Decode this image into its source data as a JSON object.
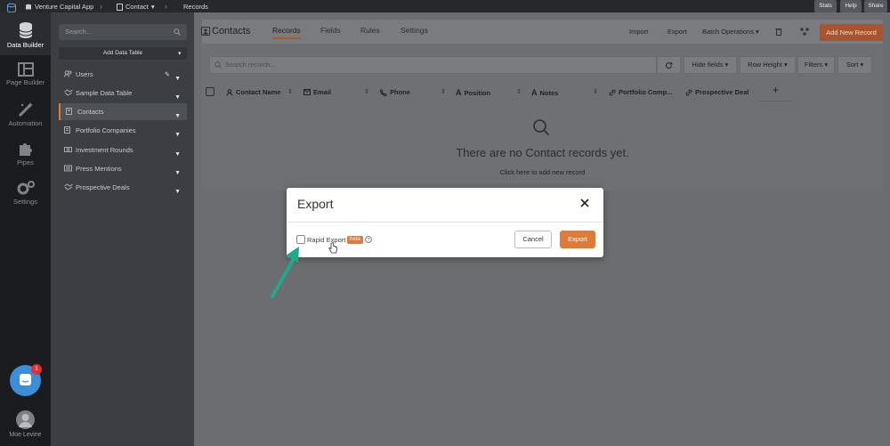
{
  "topbar": {
    "app_name": "Venture Capital App",
    "object": "Contact",
    "page": "Records",
    "buttons": [
      "Stats",
      "Help",
      "Share"
    ]
  },
  "rail": {
    "items": [
      {
        "label": "Data Builder",
        "icon": "database-icon"
      },
      {
        "label": "Page Builder",
        "icon": "layout-icon"
      },
      {
        "label": "Automation",
        "icon": "magic-wand-icon"
      },
      {
        "label": "Pipes",
        "icon": "puzzle-icon"
      },
      {
        "label": "Settings",
        "icon": "gear-icon"
      }
    ],
    "user_name": "Moe Levine",
    "chat_badge": "1"
  },
  "sidebar": {
    "search_placeholder": "Search...",
    "add_table_label": "Add Data Table",
    "items": [
      {
        "label": "Users",
        "icon": "users-icon"
      },
      {
        "label": "Sample Data Table",
        "icon": "handshake-icon"
      },
      {
        "label": "Contacts",
        "icon": "contact-icon"
      },
      {
        "label": "Portfolio Companies",
        "icon": "building-icon"
      },
      {
        "label": "Investment Rounds",
        "icon": "dollar-icon"
      },
      {
        "label": "Press Mentions",
        "icon": "newspaper-icon"
      },
      {
        "label": "Prospective Deals",
        "icon": "handshake-icon"
      }
    ]
  },
  "main": {
    "title": "Contacts",
    "tabs": [
      "Records",
      "Fields",
      "Rules",
      "Settings"
    ],
    "header_links": [
      "Import",
      "Export",
      "Batch Operations"
    ],
    "add_record_label": "Add New Record",
    "search_placeholder": "Search records...",
    "toolbar": [
      "Hide fields",
      "Row Height",
      "Filters",
      "Sort"
    ],
    "columns": [
      {
        "label": "Contact Name",
        "icon": "person-icon"
      },
      {
        "label": "Email",
        "icon": "envelope-icon"
      },
      {
        "label": "Phone",
        "icon": "phone-icon"
      },
      {
        "label": "Position",
        "icon": "text-icon"
      },
      {
        "label": "Notes",
        "icon": "text-icon"
      },
      {
        "label": "Portfolio Comp...",
        "icon": "link-icon"
      },
      {
        "label": "Prospective Deal",
        "icon": "link-icon"
      }
    ],
    "empty_title": "There are no Contact records yet.",
    "empty_link": "Click here to add new record"
  },
  "modal": {
    "title": "Export",
    "rapid_export_label": "Rapid Export",
    "rapid_export_checked": false,
    "beta_label": "beta",
    "cancel_label": "Cancel",
    "export_label": "Export"
  },
  "colors": {
    "accent": "#e07a38",
    "arrow": "#1fa889",
    "chat": "#3b8fd8"
  }
}
